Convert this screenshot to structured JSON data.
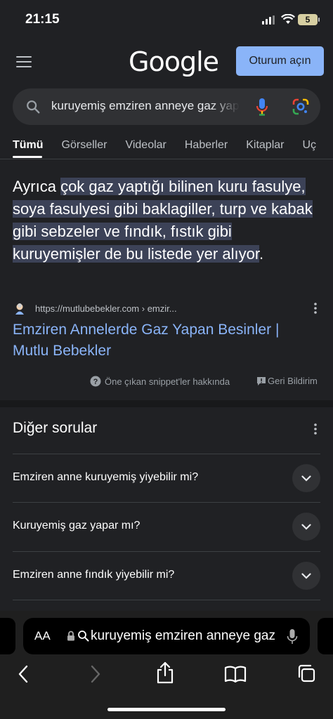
{
  "status": {
    "time": "21:15",
    "battery": "5"
  },
  "header": {
    "logo": "Google",
    "signin": "Oturum açın"
  },
  "search": {
    "query": "kuruyemiş emziren anneye gaz yapar"
  },
  "tabs": [
    {
      "label": "Tümü",
      "active": true
    },
    {
      "label": "Görseller"
    },
    {
      "label": "Videolar"
    },
    {
      "label": "Haberler"
    },
    {
      "label": "Kitaplar"
    },
    {
      "label": "Uç"
    }
  ],
  "snippet": {
    "prefix": "Ayrıca ",
    "highlight": "çok gaz yaptığı bilinen kuru fasulye, soya fasulyesi gibi baklagiller, turp ve kabak gibi sebzeler ve fındık, fıstık gibi kuruyemişler de bu listede yer alıyor",
    "suffix": ".",
    "source_url": "https://mutlubebekler.com",
    "source_path": "› emzir...",
    "title": "Emziren Annelerde Gaz Yapan Besinler | Mutlu Bebekler",
    "about_label": "Öne çıkan snippet'ler hakkında",
    "feedback_label": "Geri Bildirim"
  },
  "other_questions": {
    "title": "Diğer sorular",
    "items": [
      {
        "question": "Emziren anne kuruyemiş yiyebilir mi?"
      },
      {
        "question": "Kuruyemiş gaz yapar mı?"
      },
      {
        "question": "Emziren anne fındık yiyebilir mi?"
      }
    ]
  },
  "browser": {
    "aa_label": "AA",
    "url_text": "kuruyemiş emziren anneye gaz yapar"
  }
}
